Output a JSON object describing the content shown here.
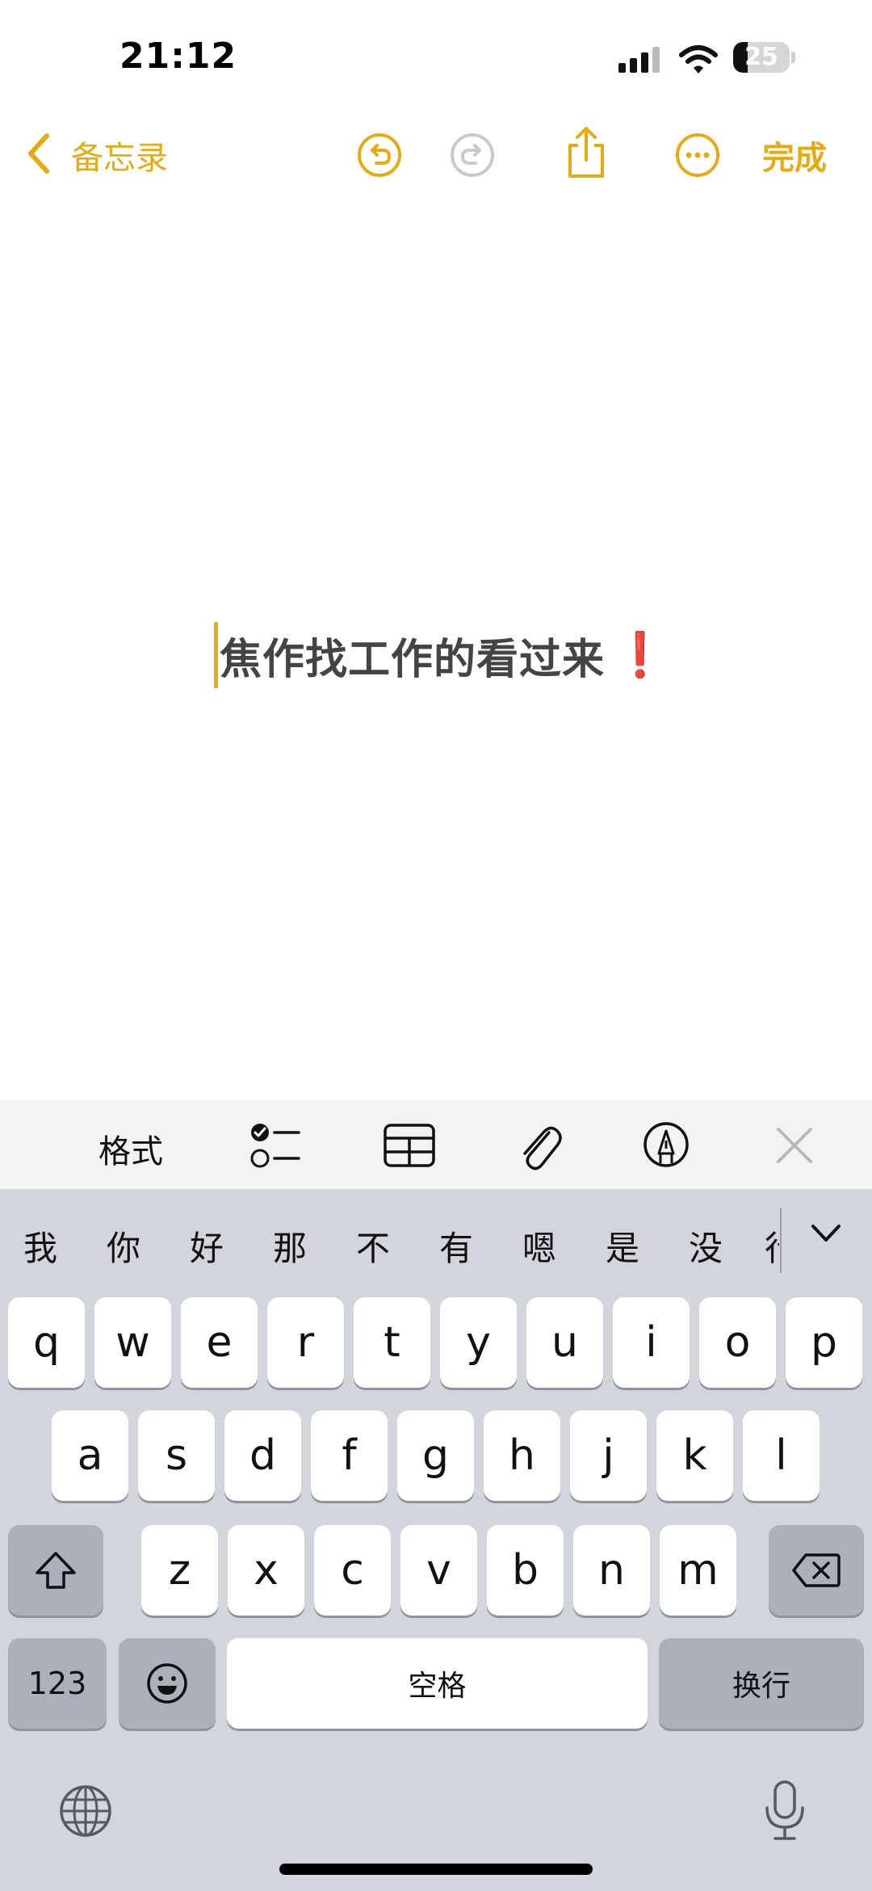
{
  "status_bar": {
    "time": "21:12",
    "battery_level": "25",
    "battery_fraction": 0.25
  },
  "nav": {
    "back_label": "备忘录",
    "done_label": "完成"
  },
  "note": {
    "text": "焦作找工作的看过来",
    "emphasis_mark": "❗"
  },
  "format_toolbar": {
    "format_label": "格式"
  },
  "keyboard": {
    "candidates": [
      "我",
      "你",
      "好",
      "那",
      "不",
      "有",
      "嗯",
      "是",
      "没",
      "行"
    ],
    "row1": [
      "q",
      "w",
      "e",
      "r",
      "t",
      "y",
      "u",
      "i",
      "o",
      "p"
    ],
    "row2": [
      "a",
      "s",
      "d",
      "f",
      "g",
      "h",
      "j",
      "k",
      "l"
    ],
    "row3": [
      "z",
      "x",
      "c",
      "v",
      "b",
      "n",
      "m"
    ],
    "numbers_label": "123",
    "space_label": "空格",
    "return_label": "换行"
  },
  "colors": {
    "accent": "#e5ab13",
    "emphasis": "#e01b24",
    "keyboard_bg": "#d2d5dc"
  },
  "icons": [
    "signal-icon",
    "wifi-icon",
    "battery-icon",
    "chevron-left-icon",
    "undo-icon",
    "redo-icon",
    "share-icon",
    "more-icon",
    "checklist-icon",
    "table-icon",
    "paperclip-icon",
    "markup-pen-icon",
    "close-icon",
    "chevron-down-icon",
    "shift-icon",
    "delete-icon",
    "emoji-icon",
    "globe-icon",
    "microphone-icon"
  ]
}
